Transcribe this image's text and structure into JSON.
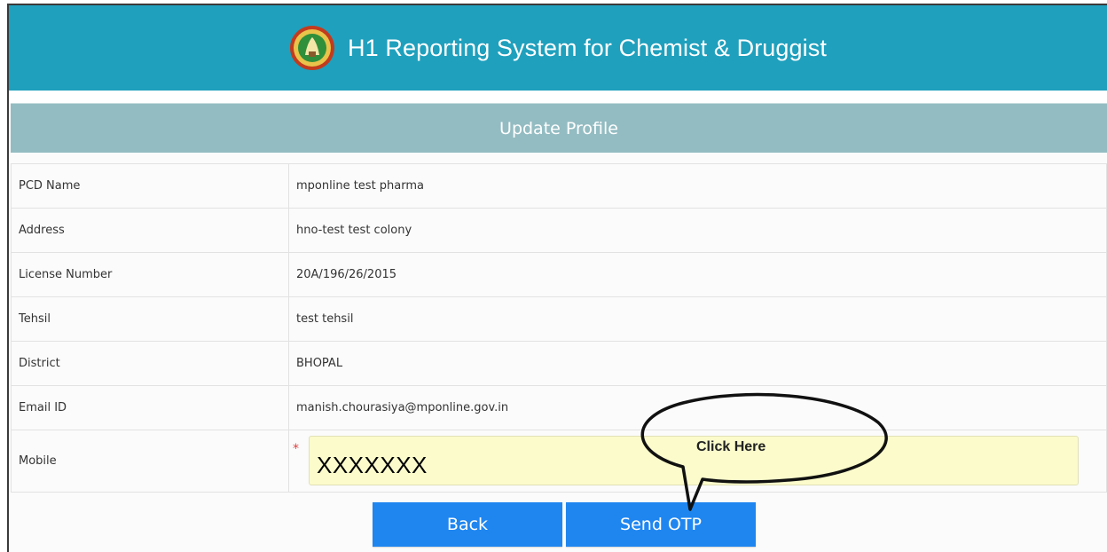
{
  "header": {
    "title": "H1 Reporting System for Chemist & Druggist",
    "logo_icon": "state-emblem-icon"
  },
  "section": {
    "title": "Update Profile"
  },
  "fields": [
    {
      "label": "PCD Name",
      "value": "mponline test pharma"
    },
    {
      "label": "Address",
      "value": "hno-test test colony"
    },
    {
      "label": "License Number",
      "value": "20A/196/26/2015"
    },
    {
      "label": "Tehsil",
      "value": "test tehsil"
    },
    {
      "label": "District",
      "value": "BHOPAL"
    },
    {
      "label": "Email ID",
      "value": "manish.chourasiya@mponline.gov.in"
    }
  ],
  "mobile": {
    "label": "Mobile",
    "required_marker": "*",
    "value": "XXXXXXX"
  },
  "buttons": {
    "back": "Back",
    "send_otp": "Send OTP"
  },
  "annotation": {
    "callout_text": "Click Here"
  },
  "colors": {
    "header_bg": "#1fa0bd",
    "section_bg": "#93bcc2",
    "button_bg": "#1f86f0",
    "input_bg": "#fbfbcb"
  }
}
